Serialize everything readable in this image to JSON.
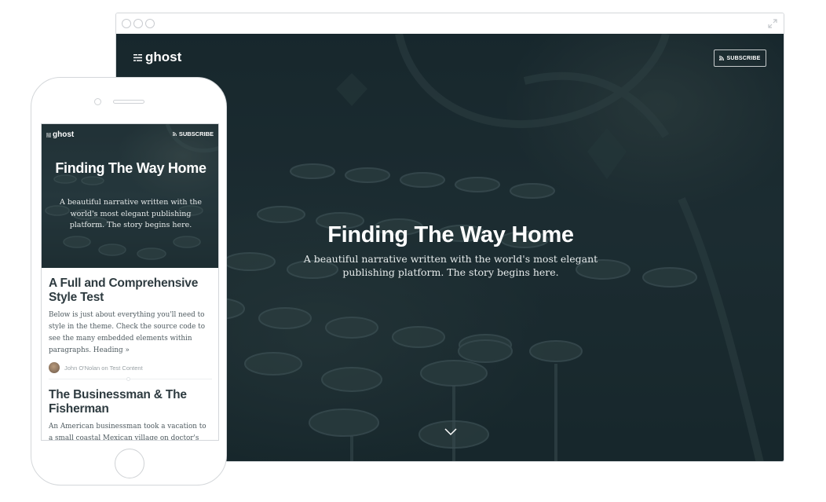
{
  "desktop": {
    "logo_text": "ghost",
    "subscribe_label": "SUBSCRIBE",
    "hero_title": "Finding The Way Home",
    "hero_description": "A beautiful narrative written with the world's most elegant publishing platform. The story begins here."
  },
  "mobile": {
    "logo_text": "ghost",
    "subscribe_label": "SUBSCRIBE",
    "hero_title": "Finding The Way Home",
    "hero_description": "A beautiful narrative written with the world's most elegant publishing platform. The story begins here.",
    "posts": [
      {
        "title": "A Full and Comprehensive Style Test",
        "excerpt": "Below is just about everything you'll need to style in the theme. Check the source code to see the many embedded elements within paragraphs. Heading »",
        "meta": "John O'Nolan on Test Content"
      },
      {
        "title": "The Businessman & The Fisherman",
        "excerpt": "An American businessman took a vacation to a small coastal Mexican village on doctor's"
      }
    ]
  },
  "colors": {
    "hero_overlay": "#1d2c30",
    "text_dark": "#2e3b40",
    "text_muted": "#9aa2a6",
    "frame_border": "#d4d7da"
  }
}
